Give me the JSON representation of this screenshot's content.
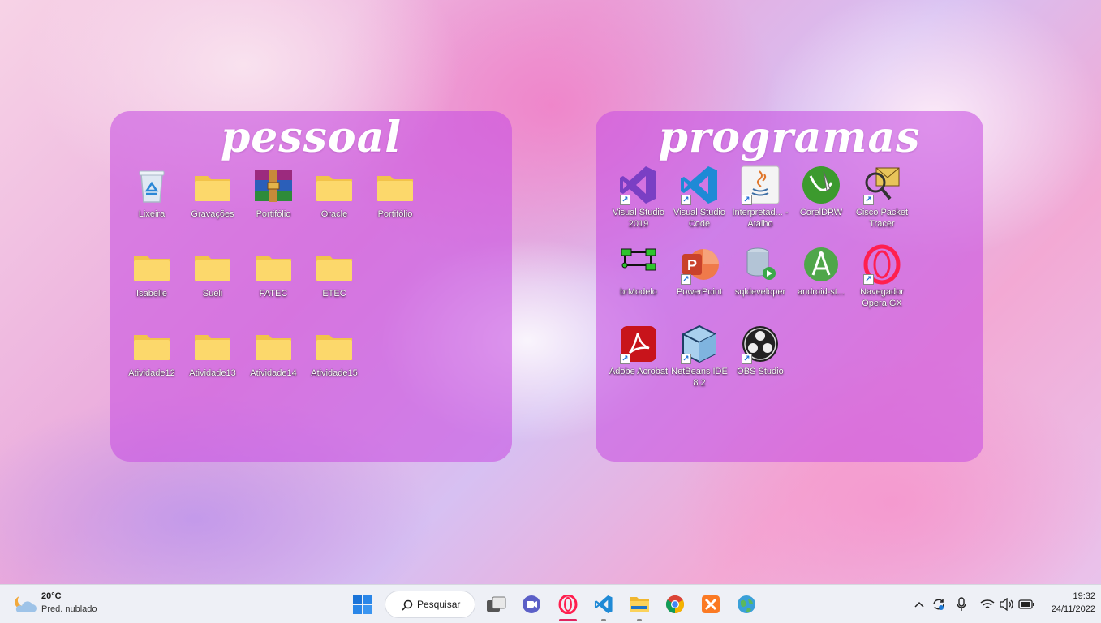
{
  "desktop": {
    "groups": [
      {
        "title": "pessoal",
        "icons": [
          {
            "label": "Lixeira",
            "icon": "recycle-bin-icon"
          },
          {
            "label": "Gravações",
            "icon": "folder-icon"
          },
          {
            "label": "Portifólio",
            "icon": "winrar-icon"
          },
          {
            "label": "Oracle",
            "icon": "folder-icon"
          },
          {
            "label": "Portifólio",
            "icon": "folder-icon"
          },
          {
            "label": "Isabelle",
            "icon": "folder-icon"
          },
          {
            "label": "Sueli",
            "icon": "folder-icon"
          },
          {
            "label": "FATEC",
            "icon": "folder-icon"
          },
          {
            "label": "ETEC",
            "icon": "folder-icon"
          },
          {
            "label": "Atividade12",
            "icon": "folder-icon"
          },
          {
            "label": "Atividade13",
            "icon": "folder-icon"
          },
          {
            "label": "Atividade14",
            "icon": "folder-icon"
          },
          {
            "label": "Atividade15",
            "icon": "folder-icon"
          }
        ]
      },
      {
        "title": "programas",
        "icons": [
          {
            "label": "Visual Studio 2019",
            "icon": "visual-studio-icon"
          },
          {
            "label": "Visual Studio Code",
            "icon": "vscode-icon"
          },
          {
            "label": "Interpretad... - Atalho",
            "icon": "java-icon"
          },
          {
            "label": "CorelDRW",
            "icon": "coreldraw-icon"
          },
          {
            "label": "Cisco Packet Tracer",
            "icon": "packet-tracer-icon"
          },
          {
            "label": "brModelo",
            "icon": "brmodelo-icon"
          },
          {
            "label": "PowerPoint",
            "icon": "powerpoint-icon"
          },
          {
            "label": "sqldeveloper",
            "icon": "sqldeveloper-icon"
          },
          {
            "label": "android-st...",
            "icon": "android-studio-icon"
          },
          {
            "label": "Navegador Opera GX",
            "icon": "opera-gx-icon"
          },
          {
            "label": "Adobe Acrobat",
            "icon": "acrobat-icon"
          },
          {
            "label": "NetBeans IDE 8.2",
            "icon": "netbeans-icon"
          },
          {
            "label": "OBS Studio",
            "icon": "obs-icon"
          }
        ]
      }
    ]
  },
  "taskbar": {
    "weather": {
      "temp": "20°C",
      "condition": "Pred. nublado",
      "icon": "partly-cloudy-icon"
    },
    "search_label": "Pesquisar",
    "apps": [
      "start-icon",
      "search-icon",
      "task-view-icon",
      "teams-chat-icon",
      "opera-icon",
      "vscode-icon",
      "file-explorer-icon",
      "chrome-icon",
      "xampp-icon",
      "world-globe-icon"
    ],
    "tray": [
      "chevron-up-icon",
      "sync-icon",
      "microphone-icon",
      "wifi-icon",
      "volume-icon",
      "battery-icon"
    ],
    "clock": {
      "time": "19:32",
      "date": "24/11/2022"
    }
  }
}
